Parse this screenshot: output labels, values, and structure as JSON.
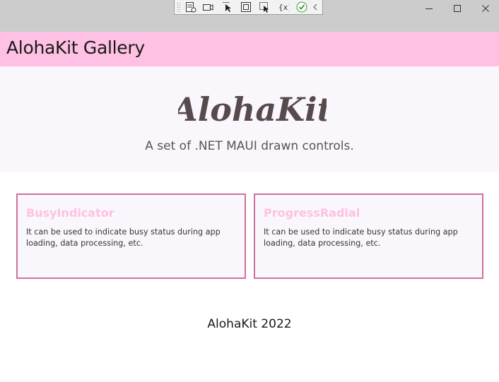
{
  "window": {
    "minimize_label": "minimize",
    "maximize_label": "maximize",
    "close_label": "close"
  },
  "debug_toolbar": {
    "icons": [
      "live-visual-tree-icon",
      "record-icon",
      "select-element-icon",
      "display-layout-adorners-icon",
      "track-focus-icon",
      "binding-failures-icon",
      "hot-reload-check-icon",
      "collapse-chevron-icon"
    ]
  },
  "header": {
    "title": "AlohaKit Gallery",
    "background": "#fec0e3"
  },
  "hero": {
    "logo_text": "AlohaKit",
    "tagline": "A set of .NET MAUI drawn controls."
  },
  "cards": [
    {
      "title": "BusyIndicator",
      "description": "It can be used to indicate busy status during app loading, data processing, etc."
    },
    {
      "title": "ProgressRadial",
      "description": "It can be used to indicate busy status during app loading, data processing, etc."
    }
  ],
  "footer": {
    "text": "AlohaKit 2022"
  },
  "colors": {
    "accent": "#fec0e3",
    "card_border": "#d0709d",
    "logo": "#574a4d"
  }
}
